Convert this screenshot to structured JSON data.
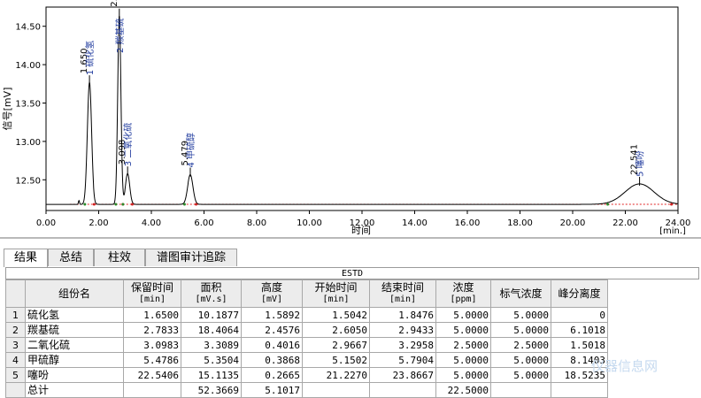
{
  "chart_data": {
    "type": "line",
    "xlabel": "时间",
    "xunit": "[min.]",
    "ylabel": "信号[mV]",
    "xlim": [
      0,
      24
    ],
    "ylim": [
      12.1,
      14.75
    ],
    "x_ticks": [
      "0.00",
      "2.00",
      "4.00",
      "6.00",
      "8.00",
      "10.00",
      "12.00",
      "14.00",
      "16.00",
      "18.00",
      "20.00",
      "22.00",
      "24.00"
    ],
    "y_ticks": [
      "12.50",
      "13.00",
      "13.50",
      "14.00",
      "14.50"
    ],
    "baseline": 12.18,
    "peaks": [
      {
        "rt": 1.65,
        "height": 1.5892,
        "width": 0.08,
        "rt_label": "1.650",
        "id_label": "1  硫化氢"
      },
      {
        "rt": 2.7833,
        "height": 2.4576,
        "width": 0.06,
        "rt_label": "2.783",
        "id_label": "2  羰基硫"
      },
      {
        "rt": 3.0983,
        "height": 0.4016,
        "width": 0.08,
        "rt_label": "3.098",
        "id_label": "3  二氧化硫"
      },
      {
        "rt": 5.4786,
        "height": 0.3868,
        "width": 0.1,
        "rt_label": "5.479",
        "id_label": "4  甲硫醇"
      },
      {
        "rt": 22.5406,
        "height": 0.2665,
        "width": 0.55,
        "rt_label": "22.541",
        "id_label": "5  噻吩"
      }
    ]
  },
  "tabs": [
    "结果",
    "总结",
    "柱效",
    "谱图审计追踪"
  ],
  "table": {
    "method": "ESTD",
    "headers": [
      {
        "label": "组份名",
        "unit": ""
      },
      {
        "label": "保留时间",
        "unit": "[min]"
      },
      {
        "label": "面积",
        "unit": "[mV.s]"
      },
      {
        "label": "高度",
        "unit": "[mV]"
      },
      {
        "label": "开始时间",
        "unit": "[min]"
      },
      {
        "label": "结束时间",
        "unit": "[min]"
      },
      {
        "label": "浓度",
        "unit": "[ppm]"
      },
      {
        "label": "标气浓度",
        "unit": ""
      },
      {
        "label": "峰分离度",
        "unit": ""
      }
    ],
    "rows": [
      {
        "idx": "1",
        "cells": [
          "硫化氢",
          "1.6500",
          "10.1877",
          "1.5892",
          "1.5042",
          "1.8476",
          "5.0000",
          "5.0000",
          "0"
        ]
      },
      {
        "idx": "2",
        "cells": [
          "羰基硫",
          "2.7833",
          "18.4064",
          "2.4576",
          "2.6050",
          "2.9433",
          "5.0000",
          "5.0000",
          "6.1018"
        ]
      },
      {
        "idx": "3",
        "cells": [
          "二氧化硫",
          "3.0983",
          "3.3089",
          "0.4016",
          "2.9667",
          "3.2958",
          "2.5000",
          "2.5000",
          "1.5018"
        ]
      },
      {
        "idx": "4",
        "cells": [
          "甲硫醇",
          "5.4786",
          "5.3504",
          "0.3868",
          "5.1502",
          "5.7904",
          "5.0000",
          "5.0000",
          "8.1403"
        ]
      },
      {
        "idx": "5",
        "cells": [
          "噻吩",
          "22.5406",
          "15.1135",
          "0.2665",
          "21.2270",
          "23.8667",
          "5.0000",
          "5.0000",
          "18.5235"
        ]
      }
    ],
    "total": {
      "label": "总计",
      "cells": [
        "",
        "52.3669",
        "5.1017",
        "",
        "",
        "22.5000",
        "",
        ""
      ]
    }
  },
  "watermark": "仪器信息网"
}
